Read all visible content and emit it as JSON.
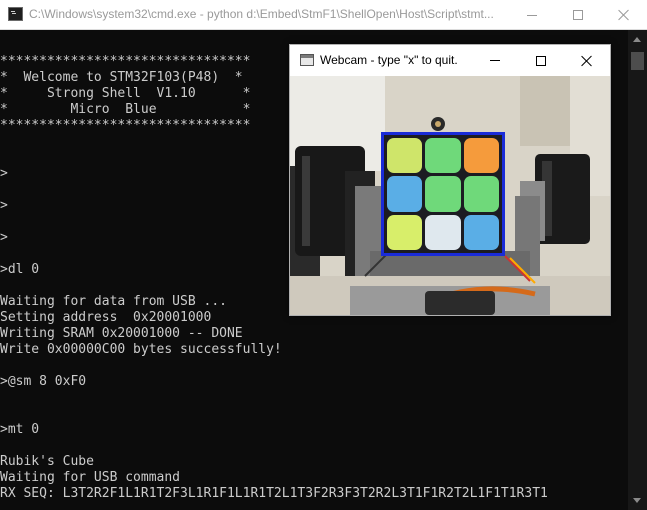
{
  "window": {
    "title": "C:\\Windows\\system32\\cmd.exe - python  d:\\Embed\\StmF1\\ShellOpen\\Host\\Script\\stmt..."
  },
  "console": {
    "lines": [
      "",
      "********************************",
      "*  Welcome to STM32F103(P48)  *",
      "*     Strong Shell  V1.10      *",
      "*        Micro  Blue           *",
      "********************************",
      "",
      "",
      ">",
      "",
      ">",
      "",
      ">",
      "",
      ">dl 0",
      "",
      "Waiting for data from USB ...",
      "Setting address  0x20001000",
      "Writing SRAM 0x20001000 -- DONE",
      "Write 0x00000C00 bytes successfully!",
      "",
      ">@sm 8 0xF0",
      "",
      "",
      ">mt 0",
      "",
      "Rubik's Cube",
      "Waiting for USB command",
      "RX SEQ: L3T2R2F1L1R1T2F3L1R1F1L1R1T2L1T3F2R3F3T2R2L3T1F1R2T2L1F1T1R3T1"
    ]
  },
  "webcam": {
    "title": "Webcam - type \"x\" to quit.",
    "overlay_color": "#1a2bd8",
    "cube_colors": [
      "#cfe56a",
      "#6fd97a",
      "#f59b3c",
      "#5aaee6",
      "#6fd97a",
      "#6fd97a",
      "#d8ee6a",
      "#dfe8ee",
      "#5aaee6"
    ]
  },
  "icons": {
    "cmd": "console-icon",
    "minimize": "minimize-icon",
    "maximize": "maximize-icon",
    "close": "close-icon"
  }
}
